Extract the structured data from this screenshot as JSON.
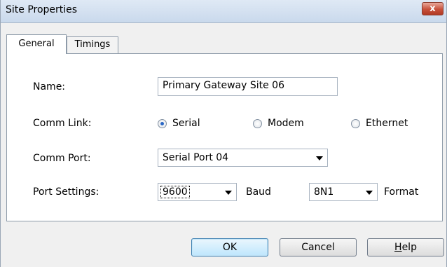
{
  "window": {
    "title": "Site Properties",
    "close_glyph": "x"
  },
  "tabs": [
    {
      "label": "General",
      "active": true
    },
    {
      "label": "Timings",
      "active": false
    }
  ],
  "form": {
    "name": {
      "label": "Name:",
      "value": "Primary Gateway Site 06"
    },
    "comm_link": {
      "label": "Comm Link:",
      "options": [
        {
          "label": "Serial",
          "selected": true
        },
        {
          "label": "Modem",
          "selected": false
        },
        {
          "label": "Ethernet",
          "selected": false
        }
      ]
    },
    "comm_port": {
      "label": "Comm Port:",
      "value": "Serial Port 04"
    },
    "port_settings": {
      "label": "Port Settings:",
      "baud_value": "9600",
      "baud_label": "Baud",
      "format_value": "8N1",
      "format_label": "Format"
    }
  },
  "buttons": {
    "ok": "OK",
    "cancel": "Cancel",
    "help_first": "H",
    "help_rest": "elp"
  },
  "icons": {
    "close": "close-icon",
    "radio": "radio-button-icon",
    "dropdown": "chevron-down-icon"
  },
  "colors": {
    "title_bar": "#c9d9ec",
    "close_button": "#c7503a",
    "radio_selected": "#2a67c5",
    "default_button": "#bee6fd"
  }
}
